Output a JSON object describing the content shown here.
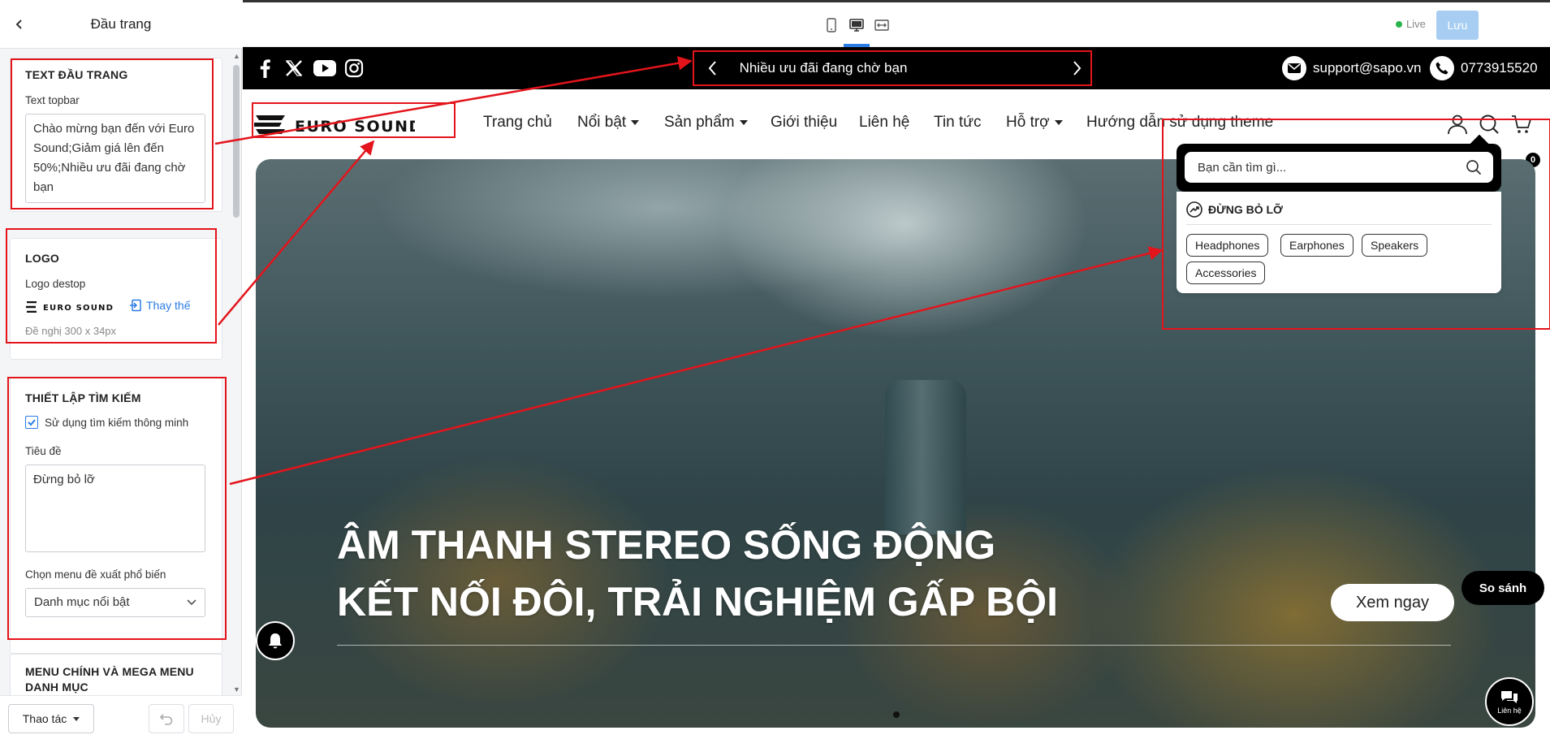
{
  "panel": {
    "title": "Đầu trang",
    "sections": {
      "text": {
        "heading": "TEXT ĐẦU TRANG",
        "field_label": "Text topbar",
        "value": "Chào mừng bạn đến với Euro Sound;Giảm giá lên đến 50%;Nhiều ưu đãi đang chờ bạn"
      },
      "logo": {
        "heading": "LOGO",
        "field_label": "Logo destop",
        "replace_label": "Thay thế",
        "hint": "Đề nghị 300 x 34px"
      },
      "search": {
        "heading": "THIẾT LẬP TÌM KIẾM",
        "smart_label": "Sử dụng tìm kiếm thông minh",
        "smart_checked": true,
        "title_label": "Tiêu đề",
        "title_value": "Đừng bỏ lỡ",
        "menu_label": "Chọn menu đề xuất phổ biến",
        "menu_value": "Danh mục nổi bật"
      },
      "menu": {
        "heading": "MENU CHÍNH VÀ MEGA MENU DANH MỤC"
      }
    },
    "footer": {
      "actions_label": "Thao tác",
      "cancel_label": "Hủy"
    }
  },
  "toolbar": {
    "devices": [
      "mobile-icon",
      "desktop-icon",
      "fullwidth-icon"
    ],
    "active_device": "desktop",
    "live_label": "Live",
    "save_label": "Lưu"
  },
  "store": {
    "announcement": "Nhiều ưu đãi đang chờ bạn",
    "email": "support@sapo.vn",
    "phone": "0773915520",
    "social": [
      "facebook-icon",
      "x-icon",
      "youtube-icon",
      "instagram-icon"
    ],
    "logo_text": "EURO SOUND",
    "nav": [
      {
        "label": "Trang chủ",
        "dropdown": false
      },
      {
        "label": "Nổi bật",
        "dropdown": true
      },
      {
        "label": "Sản phẩm",
        "dropdown": true
      },
      {
        "label": "Giới thiệu",
        "dropdown": false
      },
      {
        "label": "Liên hệ",
        "dropdown": false
      },
      {
        "label": "Tin tức",
        "dropdown": false
      },
      {
        "label": "Hỗ trợ",
        "dropdown": true
      },
      {
        "label": "Hướng dẫn sử dụng theme",
        "dropdown": false
      }
    ],
    "cart_count": "0",
    "search": {
      "placeholder": "Bạn cần tìm gì...",
      "heading": "ĐỪNG BỎ LỠ",
      "chips": [
        "Headphones",
        "Earphones",
        "Speakers",
        "Accessories"
      ]
    },
    "hero": {
      "line1": "ÂM THANH STEREO SỐNG ĐỘNG",
      "line2": "KẾT NỐI ĐÔI, TRẢI NGHIỆM GẤP BỘI",
      "cta": "Xem ngay"
    },
    "compare_label": "So sánh",
    "chat_label": "Liên hệ"
  },
  "colors": {
    "annotation_red": "#e3141b",
    "accent_blue": "#2a7be4",
    "live_green": "#2bb44a"
  }
}
